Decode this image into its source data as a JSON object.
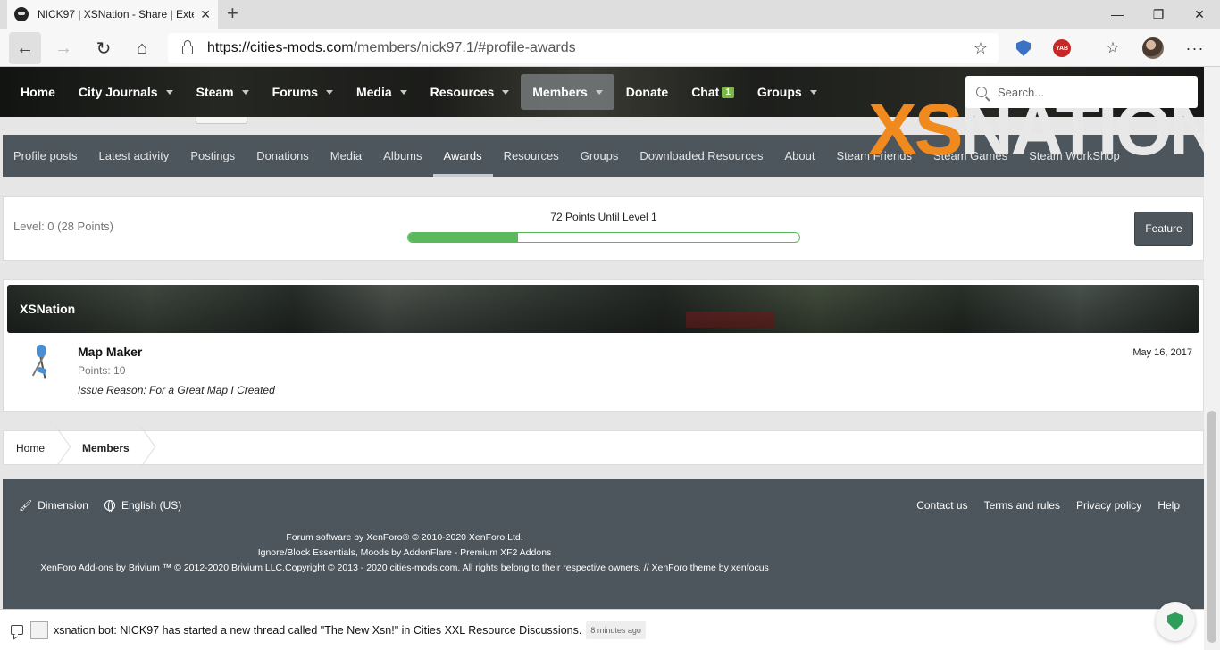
{
  "browser": {
    "tab_title": "NICK97 | XSNation - Share | Exte",
    "tab_close": "✕",
    "new_tab": "+",
    "url_host": "https://cities-mods.com",
    "url_path": "/members/nick97.1/#profile-awards",
    "bookmark_icon": "☆",
    "favorites_icon": "☆",
    "more_icon": "···",
    "ext_yab_label": "YAB",
    "minimize": "—",
    "maximize": "❐",
    "close": "✕"
  },
  "nav": {
    "items": [
      {
        "label": "Home",
        "has_caret": false
      },
      {
        "label": "City Journals",
        "has_caret": true
      },
      {
        "label": "Steam",
        "has_caret": true
      },
      {
        "label": "Forums",
        "has_caret": true
      },
      {
        "label": "Media",
        "has_caret": true
      },
      {
        "label": "Resources",
        "has_caret": true
      },
      {
        "label": "Members",
        "has_caret": true,
        "active": true
      },
      {
        "label": "Donate",
        "has_caret": false
      },
      {
        "label": "Chat",
        "has_caret": false,
        "badge": "1"
      },
      {
        "label": "Groups",
        "has_caret": true
      }
    ],
    "search_placeholder": "Search..."
  },
  "profile_tabs": [
    "Profile posts",
    "Latest activity",
    "Postings",
    "Donations",
    "Media",
    "Albums",
    "Awards",
    "Resources",
    "Groups",
    "Downloaded Resources",
    "About",
    "Steam Friends",
    "Steam Games",
    "Steam WorkShop"
  ],
  "active_profile_tab": "Awards",
  "level": {
    "level_text": "Level: 0 (28 Points)",
    "until_text": "72 Points Until Level 1",
    "progress_percent": 28,
    "feature_button": "Feature"
  },
  "awards": {
    "section_title": "XSNation",
    "items": [
      {
        "title": "Map Maker",
        "points": "Points: 10",
        "reason": "Issue Reason: For a Great Map I Created",
        "date": "May 16, 2017"
      }
    ]
  },
  "breadcrumb": [
    "Home",
    "Members"
  ],
  "footer": {
    "style_label": "Dimension",
    "language_label": "English (US)",
    "links": [
      "Contact us",
      "Terms and rules",
      "Privacy policy",
      "Help"
    ],
    "line1": "Forum software by XenForo® © 2010-2020 XenForo Ltd.",
    "line2": "Ignore/Block Essentials, Moods by AddonFlare - Premium XF2 Addons",
    "line3": "XenForo Add-ons by Brivium ™ © 2012-2020 Brivium LLC.Copyright © 2013 - 2020 cities-mods.com. All rights belong to their respective owners.   //   XenForo theme by xenfocus",
    "logo_xs": "XS",
    "logo_nation": "NATION"
  },
  "chat": {
    "message": "xsnation bot: NICK97 has started a new thread called \"The New Xsn!\" in Cities XXL Resource Discussions.",
    "time_ago": "8 minutes ago"
  },
  "colors": {
    "nav_bg": "#2b2c28",
    "tabs_bg": "#4d565d",
    "progress": "#5cb85c",
    "footer_bg": "#4d565d",
    "logo_orange": "#f08a1e"
  }
}
